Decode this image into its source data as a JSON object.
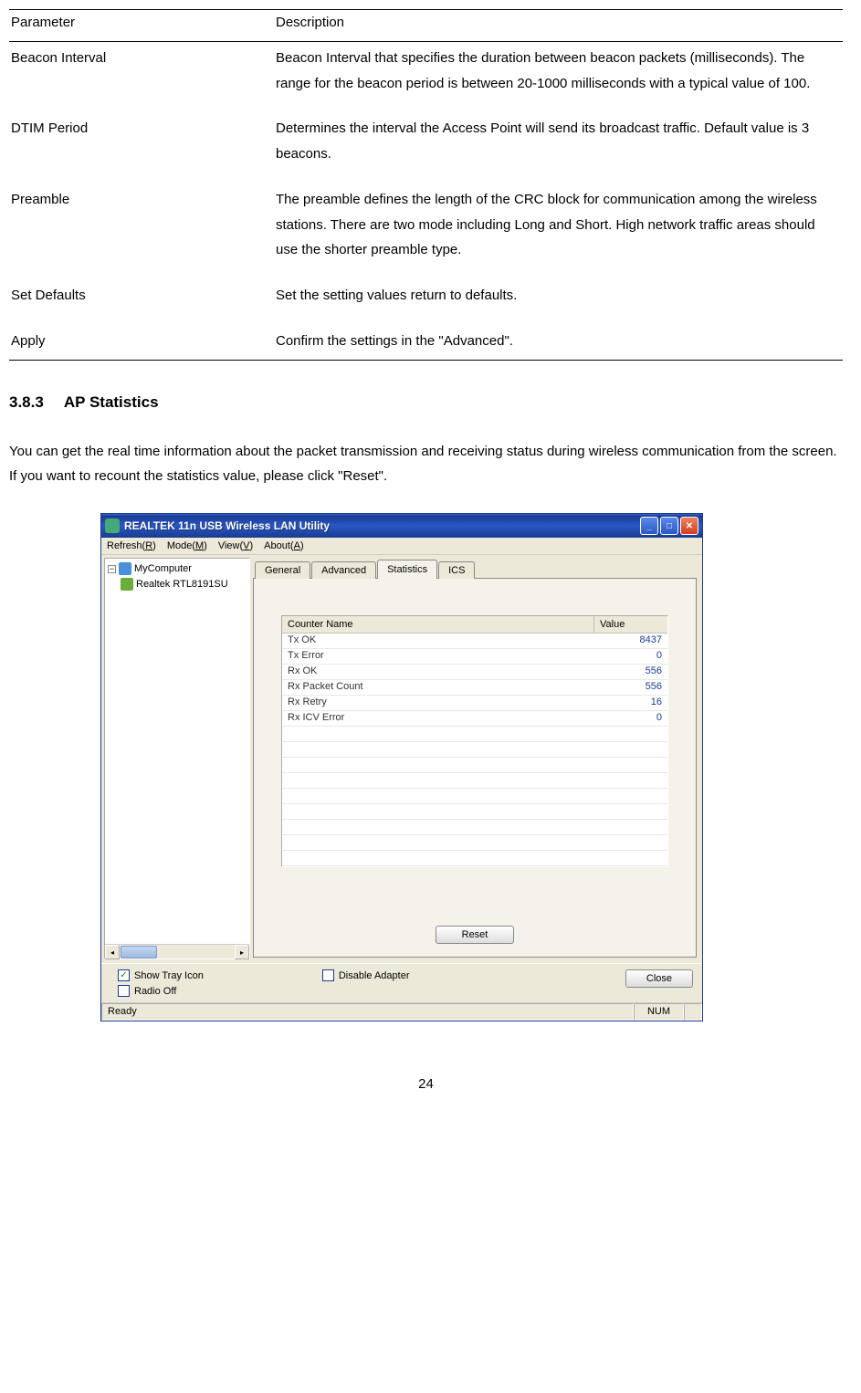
{
  "paramTable": {
    "headers": {
      "parameter": "Parameter",
      "description": "Description"
    },
    "rows": [
      {
        "param": "Beacon Interval",
        "desc": "Beacon Interval that specifies the duration between beacon packets (milliseconds). The range for the beacon period is between 20-1000 milliseconds with a typical value of 100."
      },
      {
        "param": "DTIM Period",
        "desc": "Determines the interval the Access Point will send its broadcast traffic. Default value is 3 beacons."
      },
      {
        "param": "Preamble",
        "desc": "The preamble defines the length of the CRC block for communication among the wireless stations. There are two mode including Long and Short. High network traffic areas should use the shorter preamble type."
      },
      {
        "param": "Set Defaults",
        "desc": "Set the setting values return to defaults."
      },
      {
        "param": "Apply",
        "desc": "Confirm the settings in the \"Advanced\"."
      }
    ]
  },
  "section": {
    "number": "3.8.3",
    "title": "AP Statistics"
  },
  "bodyText": "You can get the real time information about the packet transmission and receiving status during wireless communication from the screen. If you want to recount the statistics value, please click \"Reset\".",
  "window": {
    "title": "REALTEK 11n USB Wireless LAN Utility",
    "menus": {
      "refresh": {
        "label": "Refresh(",
        "key": "R",
        "suffix": ")"
      },
      "mode": {
        "label": "Mode(",
        "key": "M",
        "suffix": ")"
      },
      "view": {
        "label": "View(",
        "key": "V",
        "suffix": ")"
      },
      "about": {
        "label": "About(",
        "key": "A",
        "suffix": ")"
      }
    },
    "tree": {
      "root": "MyComputer",
      "child": "Realtek RTL8191SU"
    },
    "tabs": {
      "general": "General",
      "advanced": "Advanced",
      "statistics": "Statistics",
      "ics": "ICS"
    },
    "stats": {
      "headerName": "Counter Name",
      "headerValue": "Value",
      "rows": [
        {
          "name": "Tx OK",
          "value": "8437"
        },
        {
          "name": "Tx Error",
          "value": "0"
        },
        {
          "name": "Rx OK",
          "value": "556"
        },
        {
          "name": "Rx Packet Count",
          "value": "556"
        },
        {
          "name": "Rx Retry",
          "value": "16"
        },
        {
          "name": "Rx ICV Error",
          "value": "0"
        }
      ]
    },
    "buttons": {
      "reset": "Reset",
      "close": "Close"
    },
    "checks": {
      "showTray": "Show Tray Icon",
      "radioOff": "Radio Off",
      "disableAdapter": "Disable Adapter"
    },
    "status": {
      "ready": "Ready",
      "num": "NUM"
    }
  },
  "pageNumber": "24"
}
